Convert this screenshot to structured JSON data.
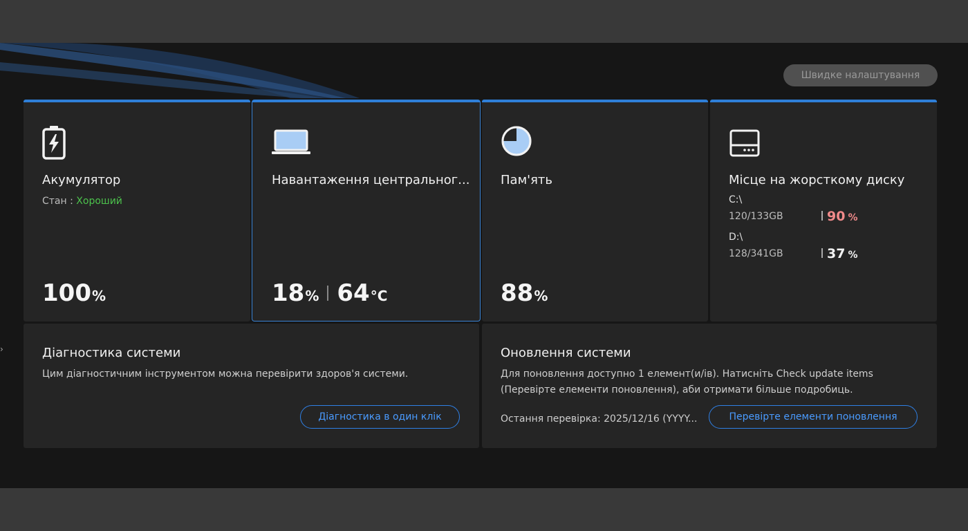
{
  "header": {
    "quick_settings_label": "Швидке налаштування"
  },
  "colors": {
    "accent": "#2f7fd8",
    "good": "#4cc24c",
    "warning": "#f08a8a",
    "link": "#4a9bff"
  },
  "battery": {
    "icon": "battery-charging-icon",
    "title": "Акумулятор",
    "status_prefix": "Стан : ",
    "status_value": "Хороший",
    "value": "100",
    "unit": "%"
  },
  "cpu": {
    "icon": "laptop-icon",
    "title": "Навантаження центральног...",
    "load_value": "18",
    "load_unit": "%",
    "temp_value": "64",
    "temp_unit": "°C"
  },
  "memory": {
    "icon": "pie-chart-icon",
    "title": "Пам'ять",
    "value": "88",
    "unit": "%"
  },
  "disk": {
    "icon": "hard-drive-icon",
    "title": "Місце на жорсткому диску",
    "drives": [
      {
        "label": "C:\\",
        "size": "120/133GB",
        "percent": "90",
        "unit": "%"
      },
      {
        "label": "D:\\",
        "size": "128/341GB",
        "percent": "37",
        "unit": "%"
      }
    ]
  },
  "diagnostics": {
    "title": "Діагностика системи",
    "description": "Цим діагностичним інструментом можна перевірити здоров'я системи.",
    "button_label": "Діагностика в один клік"
  },
  "update": {
    "title": "Оновлення системи",
    "description_line1": "Для поновлення доступно 1 елемент(и/ів). Натисніть Check update items",
    "description_line2": "(Перевірте елементи поновлення), аби отримати більше подробиць.",
    "last_check": "Остання перевірка: 2025/12/16 (YYYY...",
    "button_label": "Перевірте елементи поновлення"
  }
}
